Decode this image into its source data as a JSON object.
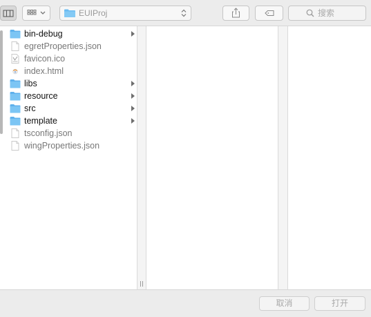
{
  "toolbar": {
    "columns_view_icon": "columns-view-icon",
    "view_options_icon": "grid-icon",
    "path": {
      "folder_icon": "folder-icon",
      "label": "EUIProj"
    },
    "share_icon": "share-icon",
    "tag_icon": "tag-icon",
    "search": {
      "icon": "search-icon",
      "placeholder": "搜索"
    }
  },
  "browser": {
    "files": [
      {
        "name": "bin-debug",
        "kind": "folder",
        "has_children": true
      },
      {
        "name": "egretProperties.json",
        "kind": "document",
        "has_children": false
      },
      {
        "name": "favicon.ico",
        "kind": "image",
        "has_children": false
      },
      {
        "name": "index.html",
        "kind": "html",
        "has_children": false
      },
      {
        "name": "libs",
        "kind": "folder",
        "has_children": true
      },
      {
        "name": "resource",
        "kind": "folder",
        "has_children": true
      },
      {
        "name": "src",
        "kind": "folder",
        "has_children": true
      },
      {
        "name": "template",
        "kind": "folder",
        "has_children": true
      },
      {
        "name": "tsconfig.json",
        "kind": "document",
        "has_children": false
      },
      {
        "name": "wingProperties.json",
        "kind": "document",
        "has_children": false
      }
    ]
  },
  "footer": {
    "cancel_label": "取消",
    "open_label": "打开"
  },
  "colors": {
    "folder": "#6bbcf2",
    "chrome": "#ececec"
  }
}
